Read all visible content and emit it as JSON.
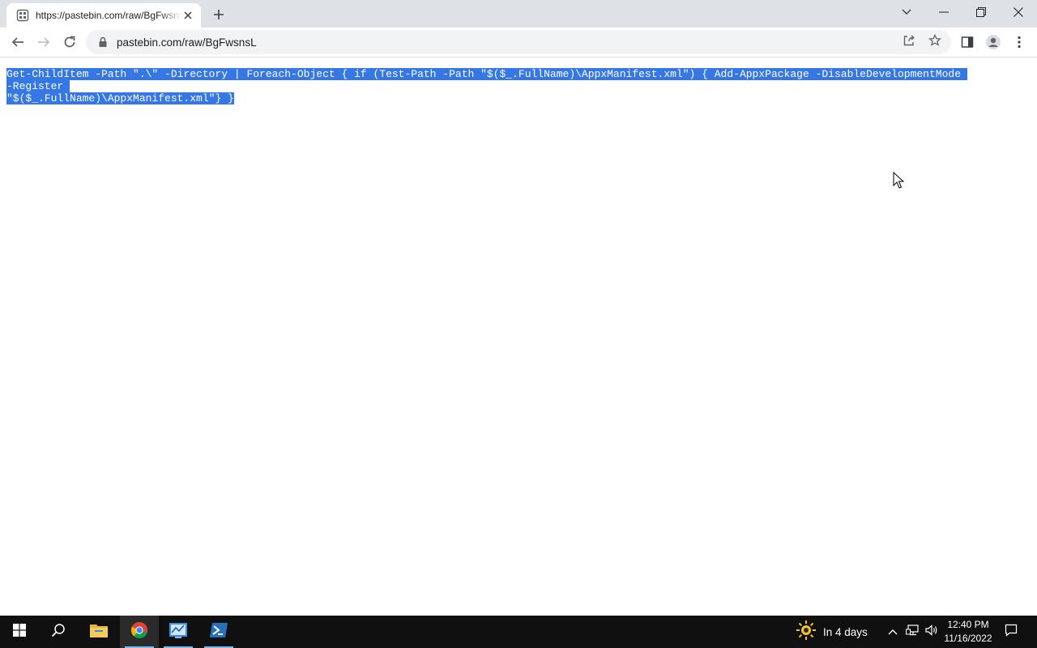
{
  "browser": {
    "tab": {
      "title": "https://pastebin.com/raw/BgFwsnsL",
      "favicon": "pastebin-icon"
    },
    "omnibox": {
      "url": "pastebin.com/raw/BgFwsnsL"
    }
  },
  "page": {
    "raw_lines": [
      "Get-ChildItem -Path \".\\\" -Directory | Foreach-Object { if (Test-Path -Path \"$($_.FullName)\\AppxManifest.xml\") { Add-AppxPackage -DisableDevelopmentMode -Register ",
      "\"$($_.FullName)\\AppxManifest.xml\"} }"
    ],
    "selection_color": "#3578e5"
  },
  "taskbar": {
    "weather": {
      "text": "In 4 days",
      "icon": "weather-sun-icon"
    },
    "clock": {
      "time": "12:40 PM",
      "date": "11/16/2022"
    },
    "apps": [
      "start-icon",
      "search-icon",
      "file-explorer-icon",
      "chrome-icon",
      "network-tool-icon",
      "powershell-icon"
    ]
  },
  "colors": {
    "tabstrip": "#dee1e6",
    "taskbar": "#101010",
    "accent": "#76b9ed"
  }
}
